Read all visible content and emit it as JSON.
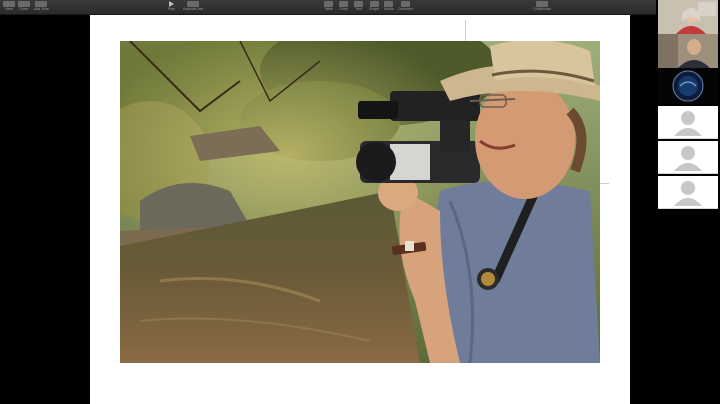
{
  "toolbar": {
    "left_buttons": [
      {
        "label": "View",
        "icon": "view-icon"
      },
      {
        "label": "Zoom",
        "icon": "zoom-icon"
      },
      {
        "label": "Add Slide",
        "icon": "add-slide-icon"
      }
    ],
    "center_buttons": [
      {
        "label": "Play",
        "icon": "play-icon"
      },
      {
        "label": "Keynote Live",
        "icon": "keynote-live-icon"
      }
    ],
    "insert_buttons": [
      {
        "label": "Table",
        "icon": "table-icon"
      },
      {
        "label": "Chart",
        "icon": "chart-icon"
      },
      {
        "label": "Text",
        "icon": "text-icon"
      },
      {
        "label": "Shape",
        "icon": "shape-icon"
      },
      {
        "label": "Media",
        "icon": "media-icon"
      },
      {
        "label": "Comment",
        "icon": "comment-icon"
      }
    ],
    "right_buttons": [
      {
        "label": "Collaborate",
        "icon": "collaborate-icon"
      }
    ]
  },
  "slide": {
    "photo_description_icon": "camera-operator-photo"
  },
  "participants": {
    "video_tiles": [
      {
        "kind": "video",
        "icon": "participant-woman-video"
      },
      {
        "kind": "video",
        "icon": "participant-man-video"
      },
      {
        "kind": "logo",
        "icon": "participant-logo-badge"
      }
    ],
    "blank_tiles": [
      {
        "kind": "avatar",
        "icon": "person-placeholder-icon"
      },
      {
        "kind": "avatar",
        "icon": "person-placeholder-icon"
      },
      {
        "kind": "avatar",
        "icon": "person-placeholder-icon"
      }
    ]
  },
  "colors": {
    "toolbar": "#2e2e2e",
    "slide": "#ffffff",
    "background": "#000000"
  }
}
